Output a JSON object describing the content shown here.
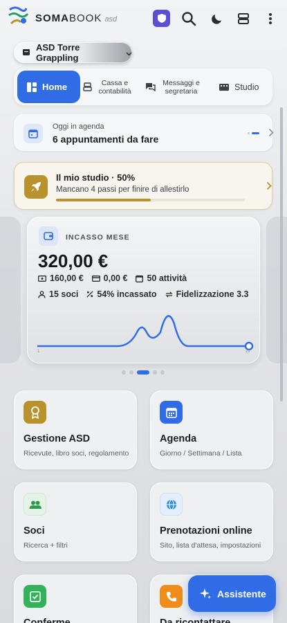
{
  "header": {
    "brand_bold": "SOMA",
    "brand_light": "BOOK",
    "brand_suffix": "asd",
    "icons": [
      "shield-icon",
      "search-icon",
      "moon-icon",
      "layers-icon",
      "more-vert-icon"
    ]
  },
  "org": {
    "name": "ASD Torre Grappling"
  },
  "tabs": [
    {
      "label": "Home",
      "active": true
    },
    {
      "label": "Cassa e contabilità"
    },
    {
      "label": "Messaggi e segretaria"
    },
    {
      "label": "Studio"
    }
  ],
  "agenda": {
    "small": "Oggi in agenda",
    "big": "6 appuntamenti da fare"
  },
  "studio": {
    "title": "Il mio studio · 50%",
    "subtitle": "Mancano 4 passi per finire di allestirlo",
    "progress": 0.5
  },
  "kpi": {
    "label": "INCASSO MESE",
    "value": "320,00 €",
    "row1": [
      {
        "icon": "cash-icon",
        "text": "160,00 €"
      },
      {
        "icon": "card-icon",
        "text": "0,00 €"
      },
      {
        "icon": "calendar-icon",
        "text": "50 attività"
      }
    ],
    "row2": [
      {
        "icon": "person-icon",
        "text": "15 soci"
      },
      {
        "icon": "percent-icon",
        "text": "54% incassato"
      },
      {
        "icon": "repeat-icon",
        "text": "Fidelizzazione 3.3"
      }
    ],
    "spark_start": "1",
    "spark_end": "21",
    "carousel_active_index": 2,
    "carousel_count": 5
  },
  "tiles": [
    {
      "title": "Gestione ASD",
      "subtitle": "Ricevute, libro soci, regolamento",
      "icon": "award-icon",
      "color": "#b8922d"
    },
    {
      "title": "Agenda",
      "subtitle": "Giorno / Settimana / Lista",
      "icon": "calendar-icon",
      "color": "#2f6ce6"
    },
    {
      "title": "Soci",
      "subtitle": "Ricerca + filtri",
      "icon": "users-icon",
      "color": "#e3f3e6"
    },
    {
      "title": "Prenotazioni online",
      "subtitle": "Sito, lista d'attesa, impostazioni",
      "icon": "globe-icon",
      "color": "#e2eef9"
    },
    {
      "title": "Conferme",
      "subtitle": "",
      "icon": "check-icon",
      "color": "#34b25a"
    },
    {
      "title": "Da ricontattare",
      "subtitle": "",
      "icon": "phone-icon",
      "color": "#f08c1a"
    }
  ],
  "fab": {
    "label": "Assistente"
  }
}
